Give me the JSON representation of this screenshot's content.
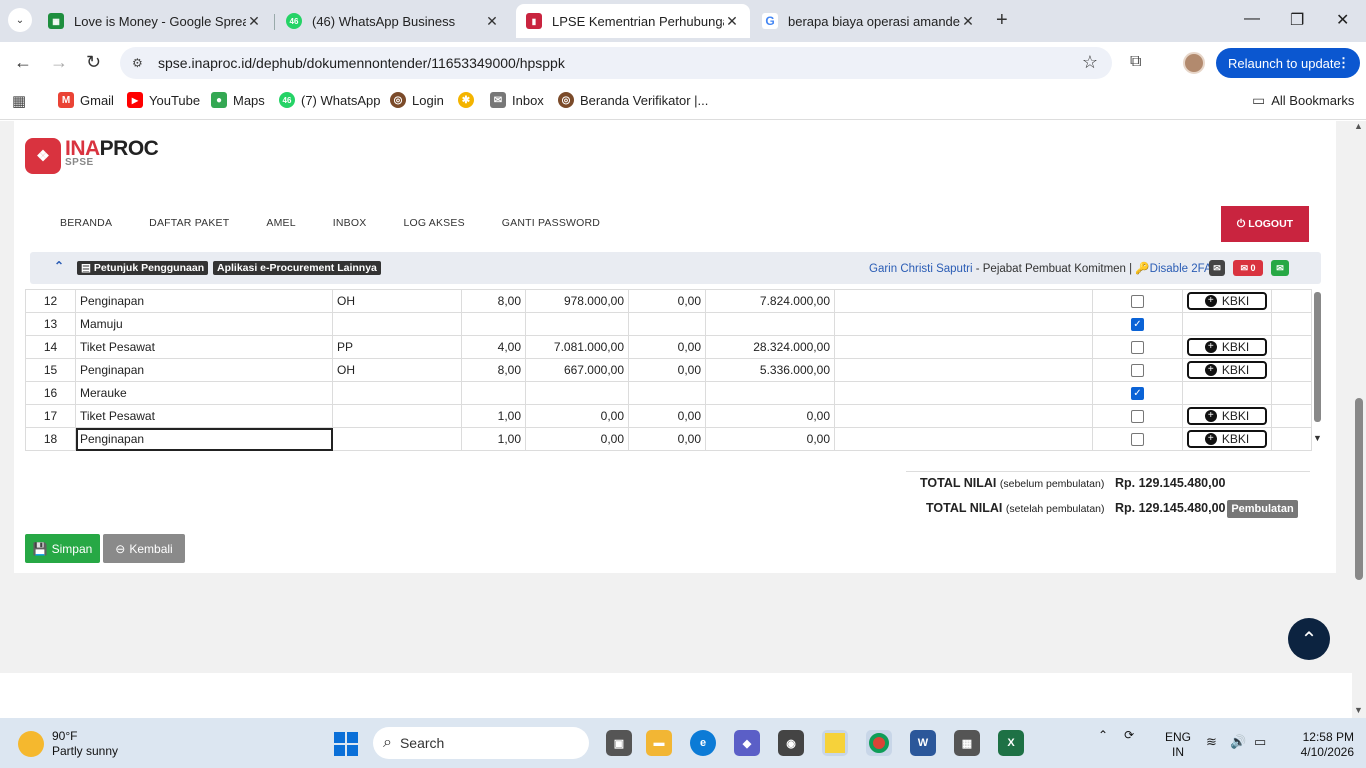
{
  "tabs": [
    {
      "title": "Love is Money - Google Spread",
      "favicon": "sheets-icon",
      "color": "#1e8e3e"
    },
    {
      "title": "(46) WhatsApp Business",
      "favicon": "whatsapp-icon",
      "color": "#25d366",
      "badge": "46"
    },
    {
      "title": "LPSE Kementrian Perhubungan",
      "favicon": "lpse-icon",
      "color": "#c9243f"
    },
    {
      "title": "berapa biaya operasi amandel -",
      "favicon": "google-icon",
      "color": "#4285f4"
    }
  ],
  "address": {
    "url": "spse.inaproc.id/dephub/dokumennontender/11653349000/hpsppk"
  },
  "relaunch_label": "Relaunch to update",
  "bookmarks": [
    {
      "label": "Gmail",
      "color": "#ea4335",
      "glyph": "M"
    },
    {
      "label": "YouTube",
      "color": "#ff0000",
      "glyph": "▶"
    },
    {
      "label": "Maps",
      "color": "#34a853",
      "glyph": "●"
    },
    {
      "label": "(7) WhatsApp",
      "color": "#25d366",
      "glyph": "46"
    },
    {
      "label": "Login",
      "color": "#7b4b2a",
      "glyph": "◎"
    },
    {
      "label": "",
      "color": "#f4b400",
      "glyph": "✱"
    },
    {
      "label": "Inbox",
      "color": "#777777",
      "glyph": "✉"
    },
    {
      "label": "Beranda Verifikator |...",
      "color": "#7b4b2a",
      "glyph": "◎"
    }
  ],
  "all_bookmarks": "All Bookmarks",
  "logo": {
    "brand_a": "INA",
    "brand_b": "PROC",
    "sub": "SPSE"
  },
  "menu": [
    "BERANDA",
    "DAFTAR PAKET",
    "AMEL",
    "INBOX",
    "LOG AKSES",
    "GANTI PASSWORD"
  ],
  "logout_label": "LOGOUT",
  "infobar": {
    "petunjuk": "Petunjuk Penggunaan",
    "aplikasi": "Aplikasi e-Procurement Lainnya",
    "user_name": "Garin Christi Saputri",
    "user_role": " - Pejabat Pembuat Komitmen | ",
    "disable_2fa": "Disable 2FA",
    "mail_count": "0"
  },
  "rows": [
    {
      "no": "12",
      "item": "Penginapan",
      "unit": "OH",
      "vol": "8,00",
      "price": "978.000,00",
      "tax": "0,00",
      "total": "7.824.000,00",
      "checked": false,
      "kbki": true
    },
    {
      "no": "13",
      "item": "Mamuju",
      "unit": "",
      "vol": "",
      "price": "",
      "tax": "",
      "total": "",
      "checked": true,
      "kbki": false
    },
    {
      "no": "14",
      "item": "Tiket Pesawat",
      "unit": "PP",
      "vol": "4,00",
      "price": "7.081.000,00",
      "tax": "0,00",
      "total": "28.324.000,00",
      "checked": false,
      "kbki": true
    },
    {
      "no": "15",
      "item": "Penginapan",
      "unit": "OH",
      "vol": "8,00",
      "price": "667.000,00",
      "tax": "0,00",
      "total": "5.336.000,00",
      "checked": false,
      "kbki": true
    },
    {
      "no": "16",
      "item": "Merauke",
      "unit": "",
      "vol": "",
      "price": "",
      "tax": "",
      "total": "",
      "checked": true,
      "kbki": false
    },
    {
      "no": "17",
      "item": "Tiket Pesawat",
      "unit": "",
      "vol": "1,00",
      "price": "0,00",
      "tax": "0,00",
      "total": "0,00",
      "checked": false,
      "kbki": true
    },
    {
      "no": "18",
      "item": "Penginapan",
      "unit": "",
      "vol": "1,00",
      "price": "0,00",
      "tax": "0,00",
      "total": "0,00",
      "checked": false,
      "kbki": true,
      "editing": true
    }
  ],
  "kbki_label": "KBKI",
  "totals": {
    "before_label": "TOTAL NILAI",
    "before_note": "(sebelum pembulatan)",
    "before_value": "Rp. 129.145.480,00",
    "after_label": "TOTAL NILAI",
    "after_note": "(setelah pembulatan)",
    "after_value": "Rp. 129.145.480,00",
    "pembulatan": "Pembulatan"
  },
  "simpan_label": "Simpan",
  "kembali_label": "Kembali",
  "taskbar": {
    "temp": "90°F",
    "condition": "Partly sunny",
    "search": "Search",
    "lang_a": "ENG",
    "lang_b": "IN",
    "time": "12:58 PM",
    "date": "4/10/2026"
  }
}
